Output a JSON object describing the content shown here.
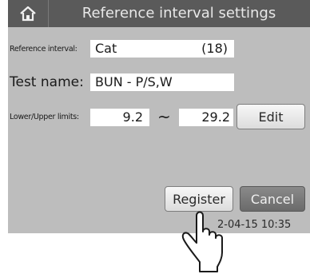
{
  "header": {
    "title": "Reference interval settings"
  },
  "reference_interval": {
    "label": "Reference interval:",
    "species": "Cat",
    "count": "(18)"
  },
  "test": {
    "label": "Test name:",
    "value": "BUN - P/S,W"
  },
  "limits": {
    "label": "Lower/Upper limits:",
    "lower": "9.2",
    "separator": "~",
    "upper": "29.2",
    "edit_label": "Edit"
  },
  "actions": {
    "register_label": "Register",
    "cancel_label": "Cancel"
  },
  "status": {
    "datetime": "2-04-15 10:35"
  },
  "icons": {
    "home": "home-icon",
    "hand": "pointing-hand-icon"
  },
  "colors": {
    "titlebar": "#5a5a5a",
    "panel": "#bdbdbd",
    "cancel": "#747474"
  }
}
